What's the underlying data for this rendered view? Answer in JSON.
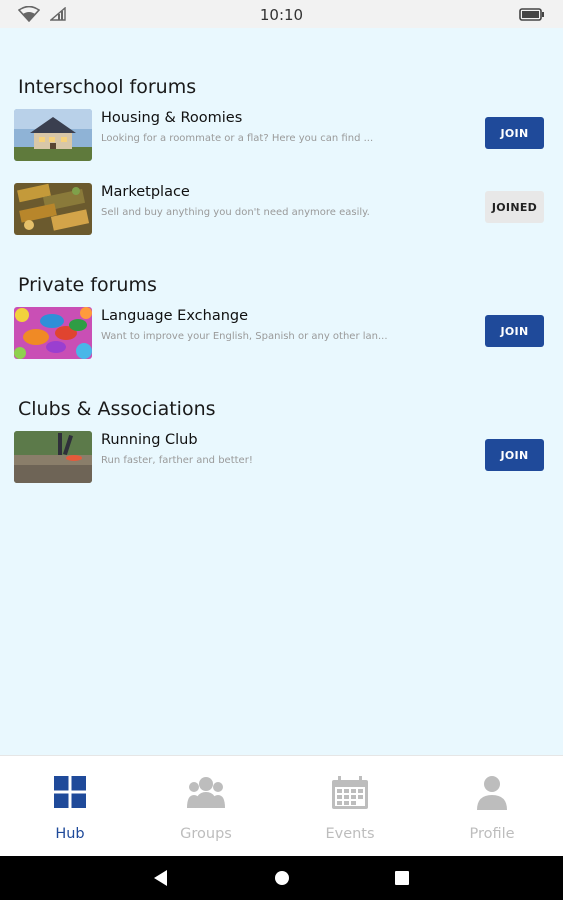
{
  "status_bar": {
    "time": "10:10"
  },
  "sections": [
    {
      "title": "Interschool forums",
      "items": [
        {
          "title": "Housing & Roomies",
          "description": "Looking for a roommate or a flat? Here you can find ...",
          "button": "JOIN",
          "thumb": "house-photo"
        },
        {
          "title": "Marketplace",
          "description": "Sell and buy anything you don't need anymore easily.",
          "button": "JOINED",
          "thumb": "market-photo"
        }
      ]
    },
    {
      "title": "Private forums",
      "items": [
        {
          "title": "Language Exchange",
          "description": "Want to improve your English, Spanish or any other lan...",
          "button": "JOIN",
          "thumb": "speech-bubbles-photo"
        }
      ]
    },
    {
      "title": "Clubs & Associations",
      "items": [
        {
          "title": "Running Club",
          "description": "Run faster, farther and better!",
          "button": "JOIN",
          "thumb": "runner-photo"
        }
      ]
    }
  ],
  "bottom_nav": [
    {
      "label": "Hub",
      "icon": "grid-icon",
      "active": true
    },
    {
      "label": "Groups",
      "icon": "group-icon",
      "active": false
    },
    {
      "label": "Events",
      "icon": "calendar-icon",
      "active": false
    },
    {
      "label": "Profile",
      "icon": "person-icon",
      "active": false
    }
  ],
  "colors": {
    "accent": "#1f4a9a",
    "background": "#e9f8fe",
    "inactive": "#bdbdbd",
    "joined_bg": "#e8e8e8"
  }
}
